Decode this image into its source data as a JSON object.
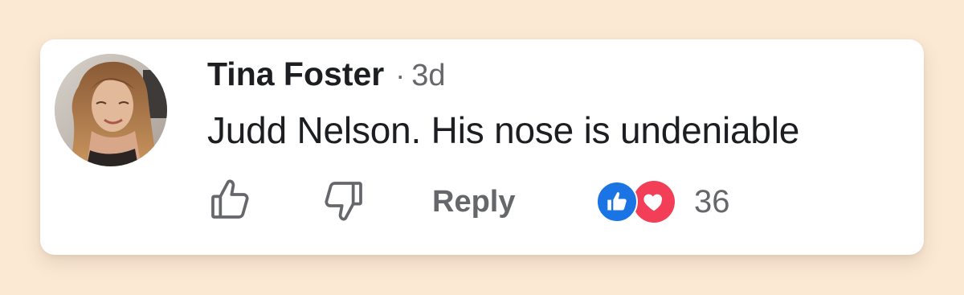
{
  "comment": {
    "author": "Tina Foster",
    "separator": "·",
    "time": "3d",
    "text": "Judd Nelson. His nose is undeniable"
  },
  "actions": {
    "like_icon": "thumbs-up-outline-icon",
    "dislike_icon": "thumbs-down-outline-icon",
    "reply_label": "Reply"
  },
  "reactions": {
    "types": [
      "like",
      "love"
    ],
    "count": "36"
  },
  "colors": {
    "background": "#fbe9d4",
    "card": "#ffffff",
    "text": "#1c1e21",
    "secondary_text": "#65676b",
    "like_blue": "#1b74e4",
    "love_red": "#f33e58"
  }
}
